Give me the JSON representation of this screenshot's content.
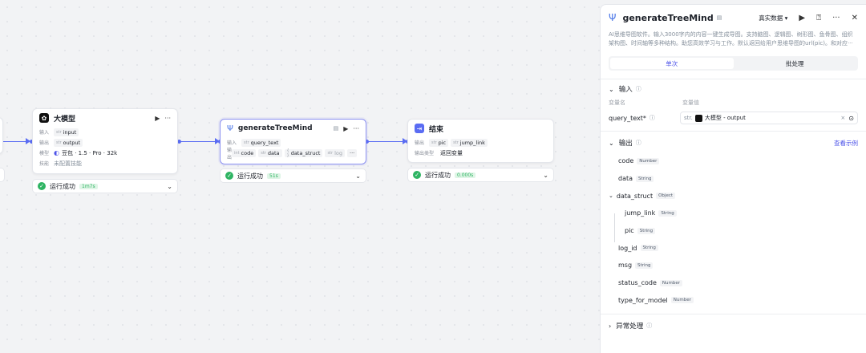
{
  "nodes": {
    "llm": {
      "title": "大模型",
      "input_label": "输入",
      "input_type": "str",
      "input_value": "input",
      "output_label": "输出",
      "output_type": "str",
      "output_value": "output",
      "model_label": "模型",
      "model_value": "豆包 · 1.5 · Pro · 32k",
      "skill_label": "技能",
      "skill_value": "未配置技能",
      "status": "运行成功",
      "time": "1m7s"
    },
    "plugin": {
      "title": "generateTreeMind",
      "input_label": "输入",
      "input_type": "str",
      "input_value": "query_text",
      "output_label": "输出",
      "outputs": [
        {
          "type": "int",
          "name": "code"
        },
        {
          "type": "str",
          "name": "data"
        },
        {
          "type": "{ }",
          "name": "data_struct"
        },
        {
          "type": "str",
          "name": "log"
        }
      ],
      "more": "···",
      "status": "运行成功",
      "time": "51s"
    },
    "end": {
      "title": "结束",
      "output_label": "输出",
      "outputs": [
        {
          "type": "str",
          "name": "pic"
        },
        {
          "type": "str",
          "name": "jump_link"
        }
      ],
      "type_label": "输出类型",
      "type_value": "返回变量",
      "status": "运行成功",
      "time": "0.000s"
    }
  },
  "panel": {
    "title": "generateTreeMind",
    "data_select": "真实数据",
    "description": "AI思维导图软件。输入3000字内的内容一键生成导图。支持脑图、逻辑图、树形图、鱼骨图、组织架构图、时间轴等多种结构。助您高效学习与工作。默认返回给用户思维导图的url(pic)。和对应···",
    "tabs": [
      "单次",
      "批处理"
    ],
    "input_section": {
      "title": "输入",
      "col_name": "变量名",
      "col_value": "变量值",
      "var_name": "query_text*",
      "ref_type": "str.",
      "ref_value": "大模型 - output"
    },
    "output_section": {
      "title": "输出",
      "link": "查看示例",
      "items": [
        {
          "name": "code",
          "type": "Number",
          "level": 0
        },
        {
          "name": "data",
          "type": "String",
          "level": 0
        },
        {
          "name": "data_struct",
          "type": "Object",
          "level": 0
        },
        {
          "name": "jump_link",
          "type": "String",
          "level": 1
        },
        {
          "name": "pic",
          "type": "String",
          "level": 1
        },
        {
          "name": "log_id",
          "type": "String",
          "level": 0
        },
        {
          "name": "msg",
          "type": "String",
          "level": 0
        },
        {
          "name": "status_code",
          "type": "Number",
          "level": 0
        },
        {
          "name": "type_for_model",
          "type": "Number",
          "level": 0
        }
      ]
    },
    "error_section": {
      "title": "异常处理"
    }
  },
  "colors": {
    "accent": "#4d53e8",
    "edge": "#5a6cf3",
    "success": "#2fb463"
  }
}
